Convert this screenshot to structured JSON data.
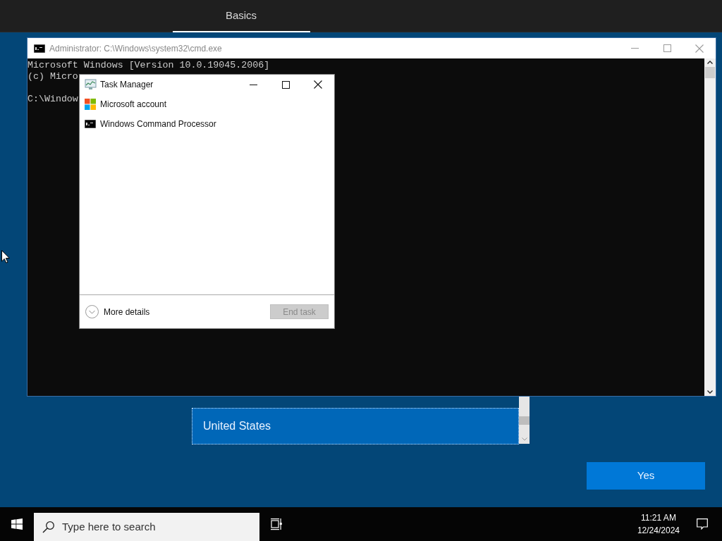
{
  "oobe": {
    "tabs": [
      {
        "label": "Basics",
        "selected": true
      }
    ],
    "region_list": {
      "items": [
        {
          "label": "United States",
          "selected": true
        }
      ]
    },
    "confirm_button": "Yes"
  },
  "console": {
    "title": "Administrator: C:\\Windows\\system32\\cmd.exe",
    "lines": [
      {
        "kind": "output",
        "text": "Microsoft Windows [Version 10.0.19045.2006]"
      },
      {
        "kind": "output",
        "text": "(c) Micro"
      },
      {
        "kind": "prompt",
        "text": "C:\\Window"
      }
    ]
  },
  "task_manager": {
    "title": "Task Manager",
    "apps": [
      {
        "name": "Microsoft account",
        "kind": "microsoft"
      },
      {
        "name": "Windows Command Processor",
        "kind": "console"
      }
    ],
    "more_details": "More details",
    "end_task": {
      "label": "End task",
      "disabled": true
    }
  },
  "taskbar": {
    "search_placeholder": "Type here to search",
    "time": "11:21 AM",
    "date": "12/24/2024"
  }
}
